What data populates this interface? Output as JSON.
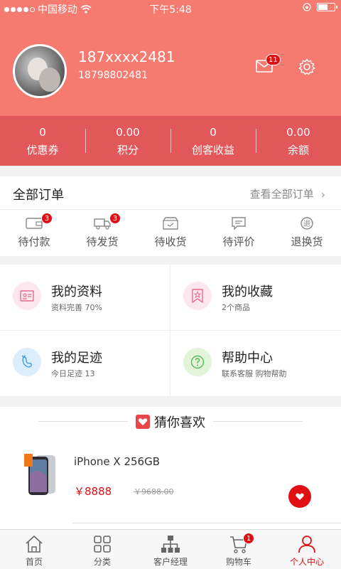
{
  "status_bar": {
    "carrier": "中国移动",
    "time": "下午5:48",
    "battery_level": 0.6
  },
  "profile": {
    "username": "187xxxx2481",
    "phone": "18798802481",
    "message_count": "11"
  },
  "stats": [
    {
      "value": "0",
      "label": "优惠券"
    },
    {
      "value": "0.00",
      "label": "积分"
    },
    {
      "value": "0",
      "label": "创客收益"
    },
    {
      "value": "0.00",
      "label": "余额"
    }
  ],
  "orders": {
    "title": "全部订单",
    "view_all": "查看全部订单",
    "items": [
      {
        "label": "待付款",
        "badge": "3"
      },
      {
        "label": "待发货",
        "badge": "3"
      },
      {
        "label": "待收货",
        "badge": ""
      },
      {
        "label": "待评价",
        "badge": ""
      },
      {
        "label": "退换货",
        "badge": ""
      }
    ]
  },
  "features": [
    {
      "title": "我的资料",
      "subtitle": "资料完善 70%"
    },
    {
      "title": "我的收藏",
      "subtitle": "2个商品"
    },
    {
      "title": "我的足迹",
      "subtitle": "今日足迹 13"
    },
    {
      "title": "帮助中心",
      "subtitle": "联系客服 购物帮助"
    }
  ],
  "recommend": {
    "title": "猜你喜欢",
    "product": {
      "name": "iPhone X 256GB",
      "price": "￥8888",
      "old_price": "￥9688.00"
    }
  },
  "tabs": [
    {
      "label": "首页"
    },
    {
      "label": "分类"
    },
    {
      "label": "客户经理"
    },
    {
      "label": "购物车",
      "badge": "1"
    },
    {
      "label": "个人中心"
    }
  ],
  "colors": {
    "header": "#f57a6f",
    "stats_bar": "#e2585a",
    "accent": "#e00f14"
  }
}
